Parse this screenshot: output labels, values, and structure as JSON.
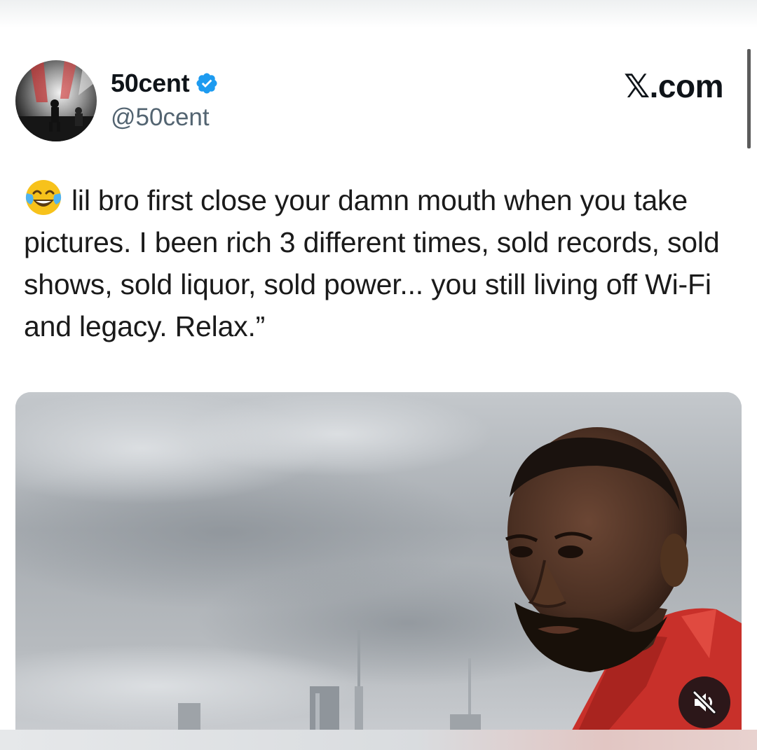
{
  "tweet": {
    "display_name": "50cent",
    "handle": "@50cent",
    "verified": true,
    "site_label": "𝕏.com",
    "text": "lil bro first close your damn mouth when you take pictures. I been rich 3 different times, sold records, sold shows, sold liquor, sold power... you still living off Wi-Fi and legacy. Relax.”",
    "leading_emoji": "face-with-tears-of-joy-icon"
  },
  "media": {
    "kind": "video",
    "muted": true
  },
  "colors": {
    "verified_badge": "#1d9bf0",
    "handle_text": "#536471",
    "primary_text": "#0f1419",
    "jacket_red": "#c8302a"
  }
}
